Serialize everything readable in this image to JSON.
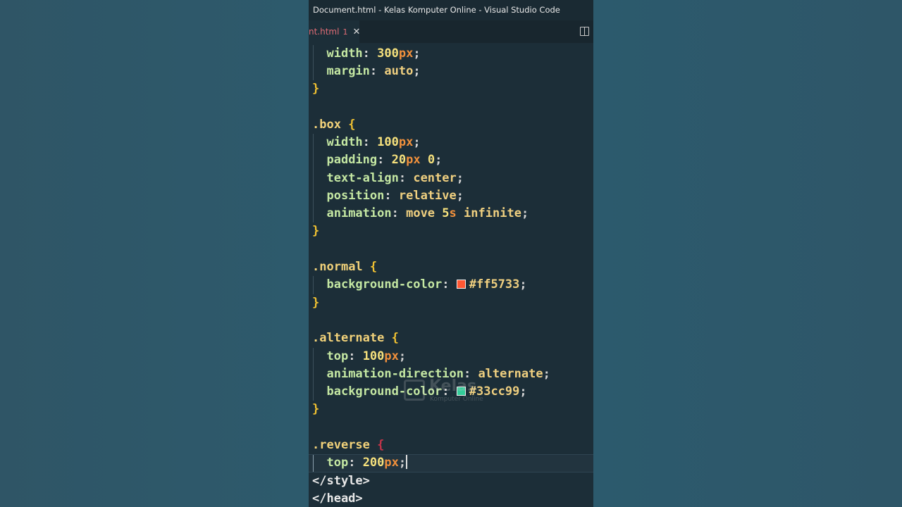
{
  "window": {
    "title": "Document.html - Kelas Komputer Online - Visual Studio Code"
  },
  "tab": {
    "name": "nt.html",
    "problems": "1",
    "close_glyph": "✕",
    "split_icon": "split-editor-icon"
  },
  "code": {
    "l1": {
      "prop": "width",
      "num": "300",
      "unit": "px"
    },
    "l2": {
      "prop": "margin",
      "val": "auto"
    },
    "box": {
      "sel": "box",
      "l1": {
        "prop": "width",
        "num": "100",
        "unit": "px"
      },
      "l2": {
        "prop": "padding",
        "num1": "20",
        "unit": "px",
        "num2": "0"
      },
      "l3": {
        "prop": "text-align",
        "val": "center"
      },
      "l4": {
        "prop": "position",
        "val": "relative"
      },
      "l5": {
        "prop": "animation",
        "val1": "move",
        "num": "5",
        "unit": "s",
        "val2": "infinite"
      }
    },
    "normal": {
      "sel": "normal",
      "prop": "background-color",
      "val": "#ff5733",
      "swatch": "#ff5733"
    },
    "alternate": {
      "sel": "alternate",
      "l1": {
        "prop": "top",
        "num": "100",
        "unit": "px"
      },
      "l2": {
        "prop": "animation-direction",
        "val": "alternate"
      },
      "l3": {
        "prop": "background-color",
        "val": "#33cc99",
        "swatch": "#33cc99"
      }
    },
    "reverse": {
      "sel": "reverse",
      "l1": {
        "prop": "top",
        "num": "200",
        "unit": "px"
      }
    },
    "close_style": "</style>",
    "close_head": "</head>"
  },
  "watermark": {
    "word": "Kelas",
    "sub": "Komputer Online"
  },
  "colors": {
    "editor_bg": "#1c2e38",
    "tab_fg": "#e06c75",
    "selector": "#f2d27a",
    "property": "#c5e8a3",
    "unit": "#f0903c"
  }
}
